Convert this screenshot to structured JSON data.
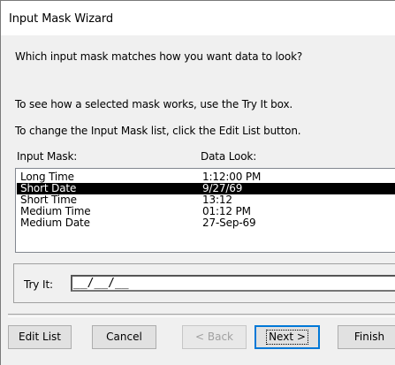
{
  "window": {
    "title": "Input Mask Wizard"
  },
  "prompt": "Which input mask matches how you want data to look?",
  "hint_try": "To see how a selected mask works, use the Try It box.",
  "hint_edit": "To change the Input Mask list, click the Edit List button.",
  "columns": {
    "mask": "Input Mask:",
    "look": "Data Look:"
  },
  "rows": [
    {
      "mask": "Long Time",
      "look": "1:12:00 PM",
      "selected": false
    },
    {
      "mask": "Short Date",
      "look": "9/27/69",
      "selected": true
    },
    {
      "mask": "Short Time",
      "look": "13:12",
      "selected": false
    },
    {
      "mask": "Medium Time",
      "look": "01:12 PM",
      "selected": false
    },
    {
      "mask": "Medium Date",
      "look": "27-Sep-69",
      "selected": false
    }
  ],
  "try_it": {
    "label": "Try It:",
    "value": "__/__/__"
  },
  "buttons": {
    "edit_list": "Edit List",
    "cancel": "Cancel",
    "back": "< Back",
    "next": "Next >",
    "finish": "Finish"
  },
  "colors": {
    "selection": "#000000",
    "default_button_border": "#0078d7"
  }
}
